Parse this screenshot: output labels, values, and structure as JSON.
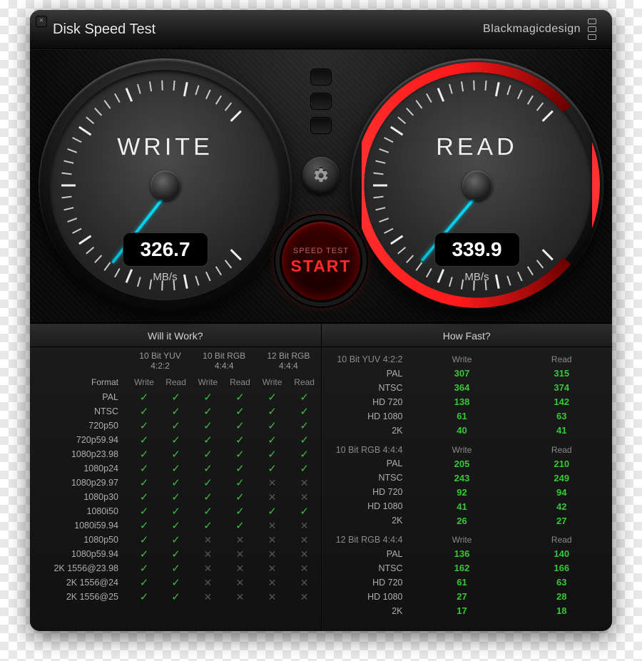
{
  "window": {
    "title": "Disk Speed Test",
    "brand": "Blackmagicdesign"
  },
  "gauges": {
    "write": {
      "label": "WRITE",
      "value": "326.7",
      "unit": "MB/s",
      "needle_deg": 35
    },
    "read": {
      "label": "READ",
      "value": "339.9",
      "unit": "MB/s",
      "needle_deg": 38
    }
  },
  "start_button": {
    "small": "SPEED TEST",
    "big": "START"
  },
  "panels": {
    "will_it_work": {
      "title": "Will it Work?",
      "col_groups": [
        "10 Bit YUV 4:2:2",
        "10 Bit RGB 4:4:4",
        "12 Bit RGB 4:4:4"
      ],
      "sub_cols": [
        "Write",
        "Read"
      ],
      "format_header": "Format",
      "rows": [
        {
          "fmt": "PAL",
          "cells": [
            "y",
            "y",
            "y",
            "y",
            "y",
            "y"
          ]
        },
        {
          "fmt": "NTSC",
          "cells": [
            "y",
            "y",
            "y",
            "y",
            "y",
            "y"
          ]
        },
        {
          "fmt": "720p50",
          "cells": [
            "y",
            "y",
            "y",
            "y",
            "y",
            "y"
          ]
        },
        {
          "fmt": "720p59.94",
          "cells": [
            "y",
            "y",
            "y",
            "y",
            "y",
            "y"
          ]
        },
        {
          "fmt": "1080p23.98",
          "cells": [
            "y",
            "y",
            "y",
            "y",
            "y",
            "y"
          ]
        },
        {
          "fmt": "1080p24",
          "cells": [
            "y",
            "y",
            "y",
            "y",
            "y",
            "y"
          ]
        },
        {
          "fmt": "1080p29.97",
          "cells": [
            "y",
            "y",
            "y",
            "y",
            "n",
            "n"
          ]
        },
        {
          "fmt": "1080p30",
          "cells": [
            "y",
            "y",
            "y",
            "y",
            "n",
            "n"
          ]
        },
        {
          "fmt": "1080i50",
          "cells": [
            "y",
            "y",
            "y",
            "y",
            "y",
            "y"
          ]
        },
        {
          "fmt": "1080i59.94",
          "cells": [
            "y",
            "y",
            "y",
            "y",
            "n",
            "n"
          ]
        },
        {
          "fmt": "1080p50",
          "cells": [
            "y",
            "y",
            "n",
            "n",
            "n",
            "n"
          ]
        },
        {
          "fmt": "1080p59.94",
          "cells": [
            "y",
            "y",
            "n",
            "n",
            "n",
            "n"
          ]
        },
        {
          "fmt": "2K 1556@23.98",
          "cells": [
            "y",
            "y",
            "n",
            "n",
            "n",
            "n"
          ]
        },
        {
          "fmt": "2K 1556@24",
          "cells": [
            "y",
            "y",
            "n",
            "n",
            "n",
            "n"
          ]
        },
        {
          "fmt": "2K 1556@25",
          "cells": [
            "y",
            "y",
            "n",
            "n",
            "n",
            "n"
          ]
        }
      ]
    },
    "how_fast": {
      "title": "How Fast?",
      "sub_cols": [
        "Write",
        "Read"
      ],
      "groups": [
        {
          "name": "10 Bit YUV 4:2:2",
          "rows": [
            {
              "fmt": "PAL",
              "w": "307",
              "r": "315"
            },
            {
              "fmt": "NTSC",
              "w": "364",
              "r": "374"
            },
            {
              "fmt": "HD 720",
              "w": "138",
              "r": "142"
            },
            {
              "fmt": "HD 1080",
              "w": "61",
              "r": "63"
            },
            {
              "fmt": "2K",
              "w": "40",
              "r": "41"
            }
          ]
        },
        {
          "name": "10 Bit RGB 4:4:4",
          "rows": [
            {
              "fmt": "PAL",
              "w": "205",
              "r": "210"
            },
            {
              "fmt": "NTSC",
              "w": "243",
              "r": "249"
            },
            {
              "fmt": "HD 720",
              "w": "92",
              "r": "94"
            },
            {
              "fmt": "HD 1080",
              "w": "41",
              "r": "42"
            },
            {
              "fmt": "2K",
              "w": "26",
              "r": "27"
            }
          ]
        },
        {
          "name": "12 Bit RGB 4:4:4",
          "rows": [
            {
              "fmt": "PAL",
              "w": "136",
              "r": "140"
            },
            {
              "fmt": "NTSC",
              "w": "162",
              "r": "166"
            },
            {
              "fmt": "HD 720",
              "w": "61",
              "r": "63"
            },
            {
              "fmt": "HD 1080",
              "w": "27",
              "r": "28"
            },
            {
              "fmt": "2K",
              "w": "17",
              "r": "18"
            }
          ]
        }
      ]
    }
  }
}
